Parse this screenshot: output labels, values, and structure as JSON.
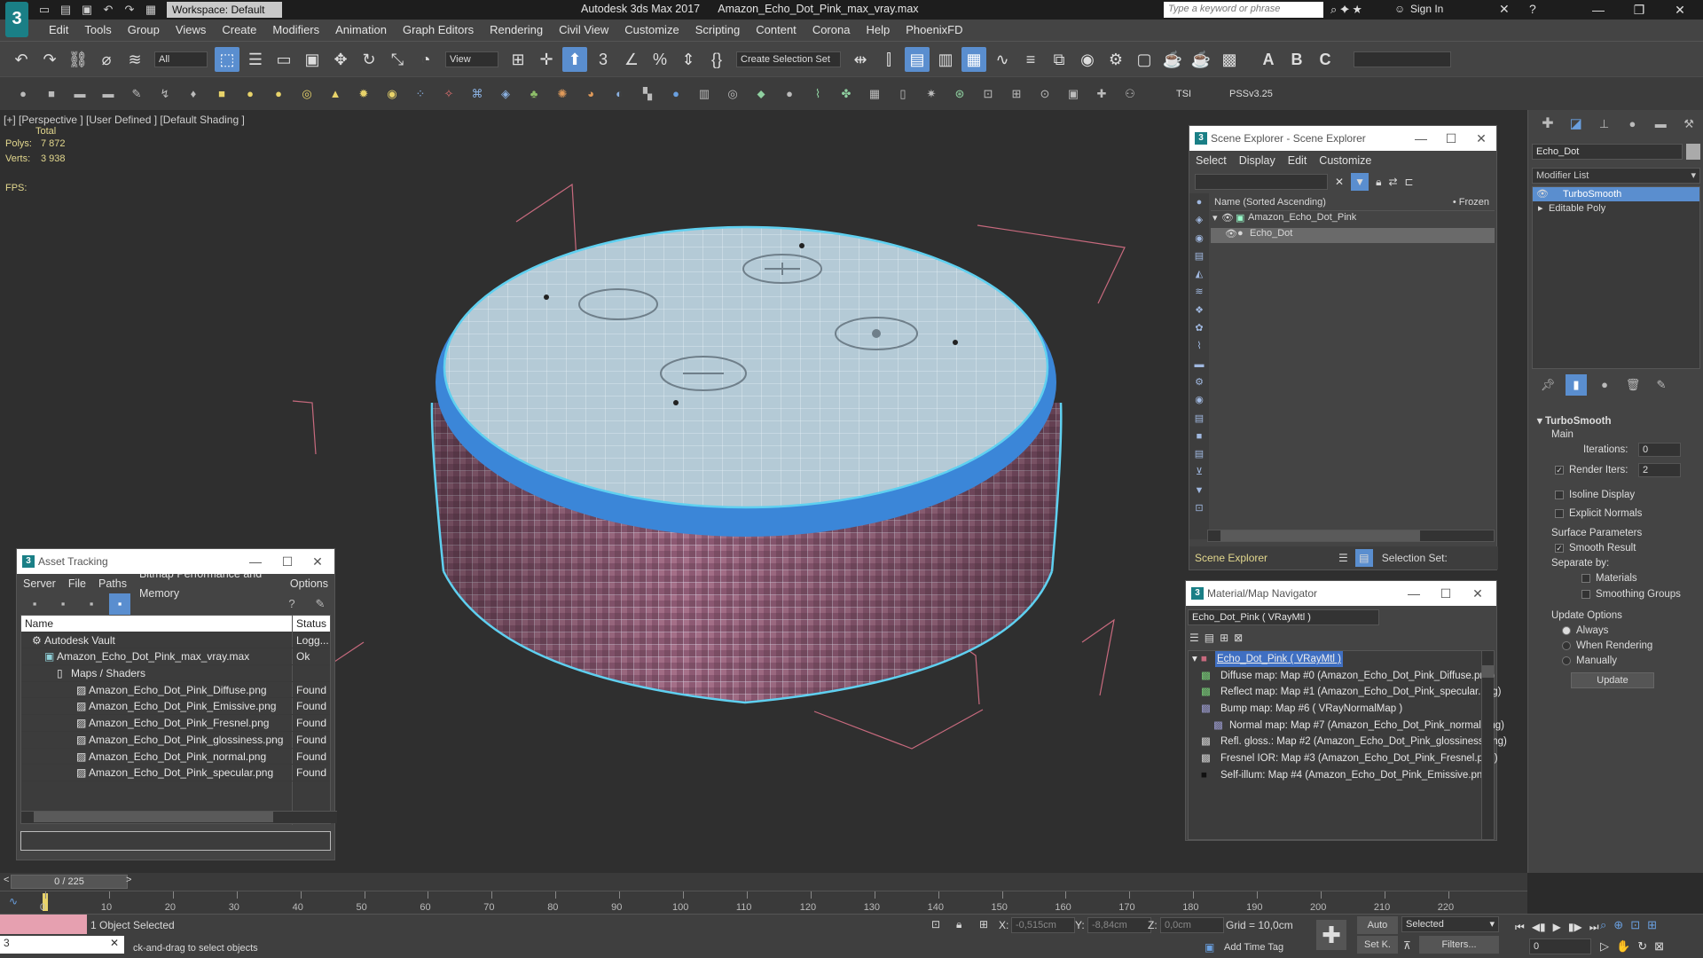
{
  "titlebar": {
    "workspace": "Workspace: Default",
    "app_title": "Autodesk 3ds Max 2017",
    "file_title": "Amazon_Echo_Dot_Pink_max_vray.max",
    "search_placeholder": "Type a keyword or phrase",
    "sign_in": "Sign In"
  },
  "menu": {
    "items": [
      "Edit",
      "Tools",
      "Group",
      "Views",
      "Create",
      "Modifiers",
      "Animation",
      "Graph Editors",
      "Rendering",
      "Civil View",
      "Customize",
      "Scripting",
      "Content",
      "Corona",
      "Help",
      "PhoenixFD"
    ]
  },
  "toolbar": {
    "filter": "All",
    "ref_coord": "View",
    "selection_set": "Create Selection Set",
    "tsi": "TSI",
    "pss": "PSSv3.25"
  },
  "viewport": {
    "label": "[+] [Perspective ]  [User Defined ]  [Default Shading ]",
    "total": "Total",
    "polys_label": "Polys:",
    "polys_value": "7 872",
    "verts_label": "Verts:",
    "verts_value": "3 938",
    "fps_label": "FPS:"
  },
  "scene_explorer": {
    "title": "Scene Explorer - Scene Explorer",
    "menu": [
      "Select",
      "Display",
      "Edit",
      "Customize"
    ],
    "col_name": "Name (Sorted Ascending)",
    "col_frozen": "• Frozen",
    "rows": [
      "Amazon_Echo_Dot_Pink",
      "Echo_Dot"
    ],
    "footer_name": "Scene Explorer",
    "selection_set": "Selection Set:"
  },
  "asset_tracking": {
    "title": "Asset Tracking",
    "menu": [
      "Server",
      "File",
      "Paths",
      "Bitmap Performance and Memory",
      "Options"
    ],
    "col_name": "Name",
    "col_status": "Status",
    "rows": [
      {
        "name": "Autodesk Vault",
        "status": "Logg..."
      },
      {
        "name": "Amazon_Echo_Dot_Pink_max_vray.max",
        "status": "Ok"
      },
      {
        "name": "Maps / Shaders",
        "status": ""
      },
      {
        "name": "Amazon_Echo_Dot_Pink_Diffuse.png",
        "status": "Found"
      },
      {
        "name": "Amazon_Echo_Dot_Pink_Emissive.png",
        "status": "Found"
      },
      {
        "name": "Amazon_Echo_Dot_Pink_Fresnel.png",
        "status": "Found"
      },
      {
        "name": "Amazon_Echo_Dot_Pink_glossiness.png",
        "status": "Found"
      },
      {
        "name": "Amazon_Echo_Dot_Pink_normal.png",
        "status": "Found"
      },
      {
        "name": "Amazon_Echo_Dot_Pink_specular.png",
        "status": "Found"
      }
    ]
  },
  "material_nav": {
    "title": "Material/Map Navigator",
    "material_field": "Echo_Dot_Pink  ( VRayMtl )",
    "rows": [
      "Echo_Dot_Pink  ( VRayMtl )",
      "Diffuse map: Map #0 (Amazon_Echo_Dot_Pink_Diffuse.png)",
      "Reflect map: Map #1 (Amazon_Echo_Dot_Pink_specular.png)",
      "Bump map: Map #6  ( VRayNormalMap )",
      "Normal map: Map #7 (Amazon_Echo_Dot_Pink_normal.png)",
      "Refl. gloss.: Map #2 (Amazon_Echo_Dot_Pink_glossiness.png)",
      "Fresnel IOR: Map #3 (Amazon_Echo_Dot_Pink_Fresnel.png)",
      "Self-illum: Map #4 (Amazon_Echo_Dot_Pink_Emissive.png)"
    ]
  },
  "command_panel": {
    "object_name": "Echo_Dot",
    "modifier_list": "Modifier List",
    "stack": [
      "TurboSmooth",
      "Editable Poly"
    ],
    "rollout": "TurboSmooth",
    "main": "Main",
    "iterations_label": "Iterations:",
    "iterations_value": "0",
    "render_iters_label": "Render Iters:",
    "render_iters_value": "2",
    "isoline": "Isoline Display",
    "explicit_normals": "Explicit Normals",
    "surface_params": "Surface Parameters",
    "smooth_result": "Smooth Result",
    "separate_by": "Separate by:",
    "materials": "Materials",
    "smoothing_groups": "Smoothing Groups",
    "update_options": "Update Options",
    "always": "Always",
    "when_rendering": "When Rendering",
    "manually": "Manually",
    "update_button": "Update"
  },
  "timeline": {
    "frame": "0 / 225",
    "ticks": [
      "0",
      "10",
      "20",
      "30",
      "40",
      "50",
      "60",
      "70",
      "80",
      "90",
      "100",
      "110",
      "120",
      "130",
      "140",
      "150",
      "160",
      "170",
      "180",
      "190",
      "200",
      "210",
      "220"
    ]
  },
  "status": {
    "selected": "1 Object Selected",
    "prompt": "ck-and-drag to select objects",
    "x_label": "X:",
    "x_value": "-0,515cm",
    "y_label": "Y:",
    "y_value": "-8,84cm",
    "z_label": "Z:",
    "z_value": "0,0cm",
    "grid": "Grid = 10,0cm",
    "add_time_tag": "Add Time Tag",
    "auto": "Auto",
    "set_k": "Set K.",
    "selected_dropdown": "Selected",
    "filters": "Filters...",
    "frame_field": "0"
  },
  "colors": {
    "accent": "#5a8ecf",
    "teal": "#1a7f86",
    "wire_highlight": "#5fd0f0"
  }
}
